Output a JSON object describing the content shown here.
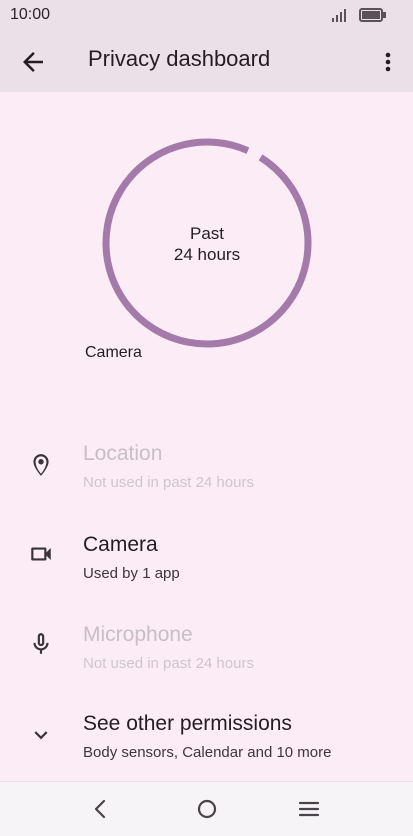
{
  "status_bar": {
    "time": "10:00"
  },
  "app_bar": {
    "title": "Privacy dashboard"
  },
  "usage_chart": {
    "center_line1": "Past",
    "center_line2": "24 hours",
    "legend_label": "Camera",
    "ring_color": "#a47aab"
  },
  "permissions": [
    {
      "title": "Location",
      "subtitle": "Not used in past 24 hours",
      "icon": "location-pin-icon",
      "active": false
    },
    {
      "title": "Camera",
      "subtitle": "Used by 1 app",
      "icon": "camera-icon",
      "active": true
    },
    {
      "title": "Microphone",
      "subtitle": "Not used in past 24 hours",
      "icon": "microphone-icon",
      "active": false
    }
  ],
  "other_permissions": {
    "title": "See other permissions",
    "subtitle": "Body sensors, Calendar and 10 more",
    "icon": "chevron-down-icon"
  },
  "nav": {
    "back_icon": "back-icon",
    "home_icon": "home-icon",
    "menu_icon": "menu-icon"
  }
}
